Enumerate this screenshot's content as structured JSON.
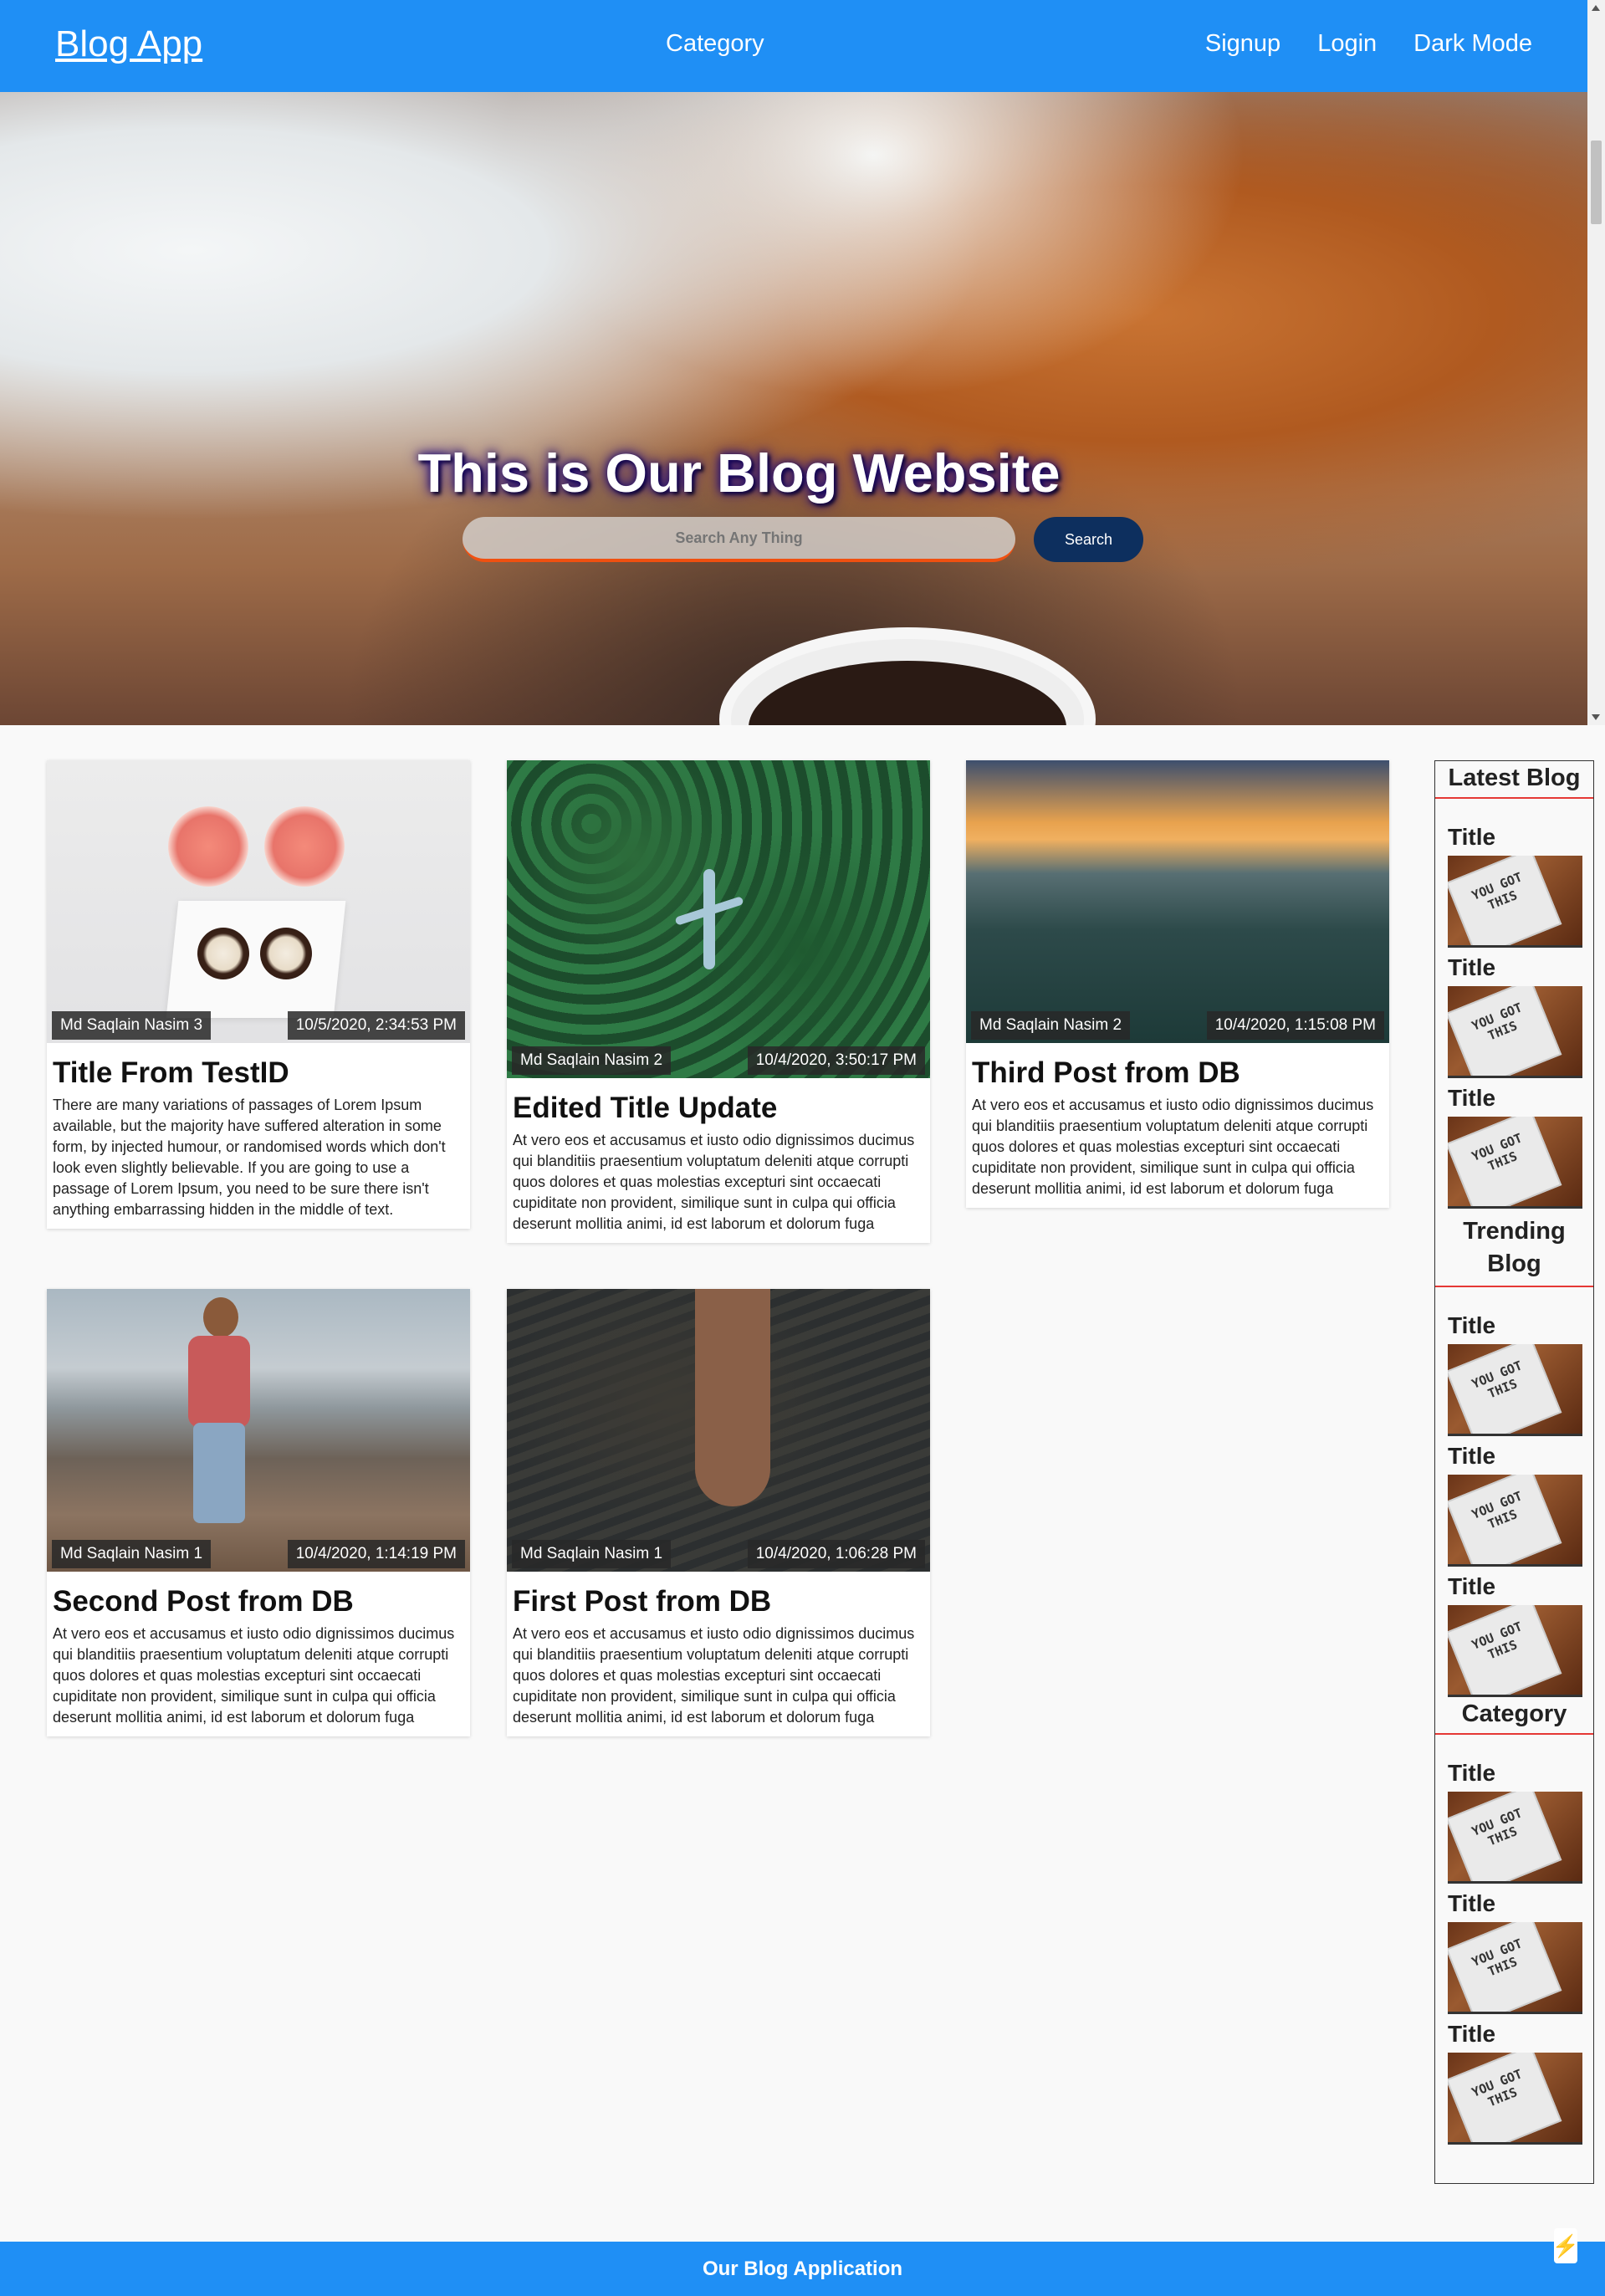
{
  "navbar": {
    "brand": "Blog App",
    "center_link": "Category",
    "links": [
      "Signup",
      "Login",
      "Dark Mode"
    ]
  },
  "hero": {
    "title": "This is Our Blog Website",
    "search_placeholder": "Search Any Thing",
    "search_button": "Search",
    "bolt_icon": "⚡"
  },
  "posts": [
    {
      "author": "Md Saqlain Nasim 3",
      "date": "10/5/2020, 2:34:53 PM",
      "title": "Title From TestID",
      "body": "There are many variations of passages of Lorem Ipsum available, but the majority have suffered alteration in some form, by injected humour, or randomised words which don't look even slightly believable. If you are going to use a passage of Lorem Ipsum, you need to be sure there isn't anything embarrassing hidden in the middle of text."
    },
    {
      "author": "Md Saqlain Nasim 2",
      "date": "10/4/2020, 3:50:17 PM",
      "title": "Edited Title Update",
      "body": "At vero eos et accusamus et iusto odio dignissimos ducimus qui blanditiis praesentium voluptatum deleniti atque corrupti quos dolores et quas molestias excepturi sint occaecati cupiditate non provident, similique sunt in culpa qui officia deserunt mollitia animi, id est laborum et dolorum fuga"
    },
    {
      "author": "Md Saqlain Nasim 2",
      "date": "10/4/2020, 1:15:08 PM",
      "title": "Third Post from DB",
      "body": "At vero eos et accusamus et iusto odio dignissimos ducimus qui blanditiis praesentium voluptatum deleniti atque corrupti quos dolores et quas molestias excepturi sint occaecati cupiditate non provident, similique sunt in culpa qui officia deserunt mollitia animi, id est laborum et dolorum fuga"
    },
    {
      "author": "Md Saqlain Nasim 1",
      "date": "10/4/2020, 1:14:19 PM",
      "title": "Second Post from DB",
      "body": "At vero eos et accusamus et iusto odio dignissimos ducimus qui blanditiis praesentium voluptatum deleniti atque corrupti quos dolores et quas molestias excepturi sint occaecati cupiditate non provident, similique sunt in culpa qui officia deserunt mollitia animi, id est laborum et dolorum fuga"
    },
    {
      "author": "Md Saqlain Nasim 1",
      "date": "10/4/2020, 1:06:28 PM",
      "title": "First Post from DB",
      "body": "At vero eos et accusamus et iusto odio dignissimos ducimus qui blanditiis praesentium voluptatum deleniti atque corrupti quos dolores et quas molestias excepturi sint occaecati cupiditate non provident, similique sunt in culpa qui officia deserunt mollitia animi, id est laborum et dolorum fuga"
    }
  ],
  "sidebar": {
    "sections": [
      {
        "heading": "Latest Blog",
        "items": [
          "Title",
          "Title",
          "Title"
        ]
      },
      {
        "heading": "Trending Blog",
        "items": [
          "Title",
          "Title",
          "Title"
        ]
      },
      {
        "heading": "Category",
        "items": [
          "Title",
          "Title",
          "Title"
        ]
      }
    ],
    "thumb_text": "YOU GOT THIS"
  },
  "footer": {
    "text": "Our Blog Application"
  },
  "colors": {
    "primary": "#1f8ff5",
    "search_button": "#0d2f5e",
    "accent_red": "#e53935"
  }
}
